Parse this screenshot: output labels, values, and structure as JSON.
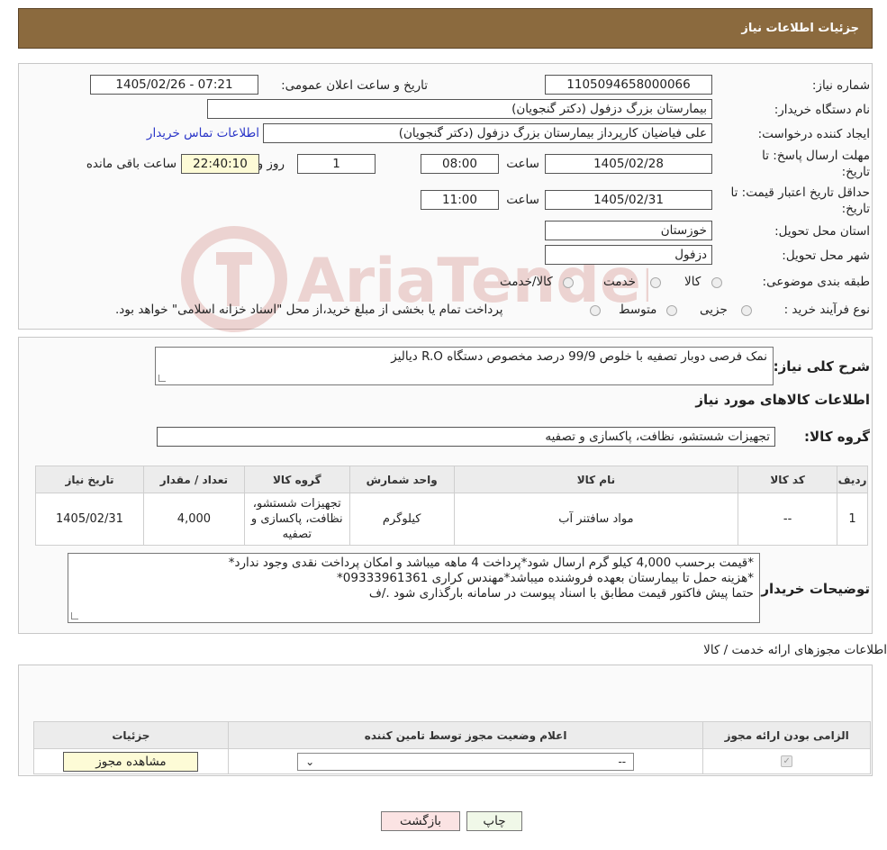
{
  "header": {
    "title": "جزئیات اطلاعات نیاز"
  },
  "form": {
    "need_number_label": "شماره نیاز:",
    "need_number": "1105094658000066",
    "announce_label": "تاریخ و ساعت اعلان عمومی:",
    "announce_value": "1405/02/26 - 07:21",
    "buyer_label": "نام دستگاه خریدار:",
    "buyer_value": "بیمارستان بزرگ دزفول (دکتر گنجویان)",
    "creator_label": "ایجاد کننده درخواست:",
    "creator_value": "علی فیاضیان کارپرداز بیمارستان بزرگ دزفول (دکتر گنجویان)",
    "contact_link": "اطلاعات تماس خریدار",
    "deadline_label_1": "مهلت ارسال پاسخ: تا",
    "deadline_label_2": "تاریخ:",
    "deadline_date": "1405/02/28",
    "time_label": "ساعت",
    "deadline_time": "08:00",
    "days_value": "1",
    "days_label": "روز و",
    "remaining_time": "22:40:10",
    "remaining_label": "ساعت باقی مانده",
    "validity_label_1": "حداقل تاریخ اعتبار قیمت: تا",
    "validity_label_2": "تاریخ:",
    "validity_date": "1405/02/31",
    "validity_time": "11:00",
    "province_label": "استان محل تحویل:",
    "province_value": "خوزستان",
    "city_label": "شهر محل تحویل:",
    "city_value": "دزفول",
    "category_label": "طبقه بندی موضوعی:",
    "category_options": [
      "کالا",
      "خدمت",
      "کالا/خدمت"
    ],
    "process_label": "نوع فرآیند خرید :",
    "process_options": [
      "جزیی",
      "متوسط"
    ],
    "process_note": "پرداخت تمام یا بخشی از مبلغ خرید،از محل \"اسناد خزانه اسلامی\" خواهد بود."
  },
  "summary": {
    "desc_label": "شرح کلی نیاز:",
    "desc_value": "نمک فرصی دوبار تصفیه با خلوص 99/9 درصد مخصوص دستگاه R.O دیالیز",
    "goods_info_title": "اطلاعات کالاهای مورد نیاز",
    "group_label": "گروه کالا:",
    "group_value": "تجهیزات شستشو، نظافت، پاکسازی و تصفیه"
  },
  "goods_table": {
    "headers": [
      "ردیف",
      "کد کالا",
      "نام کالا",
      "واحد شمارش",
      "گروه کالا",
      "تعداد / مقدار",
      "تاریخ نیاز"
    ],
    "rows": [
      [
        "1",
        "--",
        "مواد سافتنر آب",
        "کیلوگرم",
        "تجهیزات شستشو، نظافت، پاکسازی و تصفیه",
        "4,000",
        "1405/02/31"
      ]
    ]
  },
  "buyer_notes": {
    "label": "توضیحات خریدار:",
    "lines": [
      "*قیمت برحسب 4,000 کیلو گرم ارسال شود*پرداخت 4 ماهه میباشد و امکان پرداخت نقدی وجود ندارد*",
      "*هزینه حمل تا بیمارستان بعهده فروشنده میباشد*مهندس کراری 09333961361*",
      "حتما پیش فاکتور قیمت مطابق با اسناد پیوست در سامانه بارگذاری شود ./ف"
    ]
  },
  "permits": {
    "title": "اطلاعات مجوزهای ارائه خدمت / کالا",
    "headers": [
      "الزامی بودن ارائه مجوز",
      "اعلام وضعیت مجوز توسط تامین کننده",
      "جزئیات"
    ],
    "select_value": "--",
    "view_button": "مشاهده مجوز"
  },
  "footer": {
    "print_button": "چاپ",
    "back_button": "بازگشت"
  },
  "watermark_text": "AriaTender.neT"
}
